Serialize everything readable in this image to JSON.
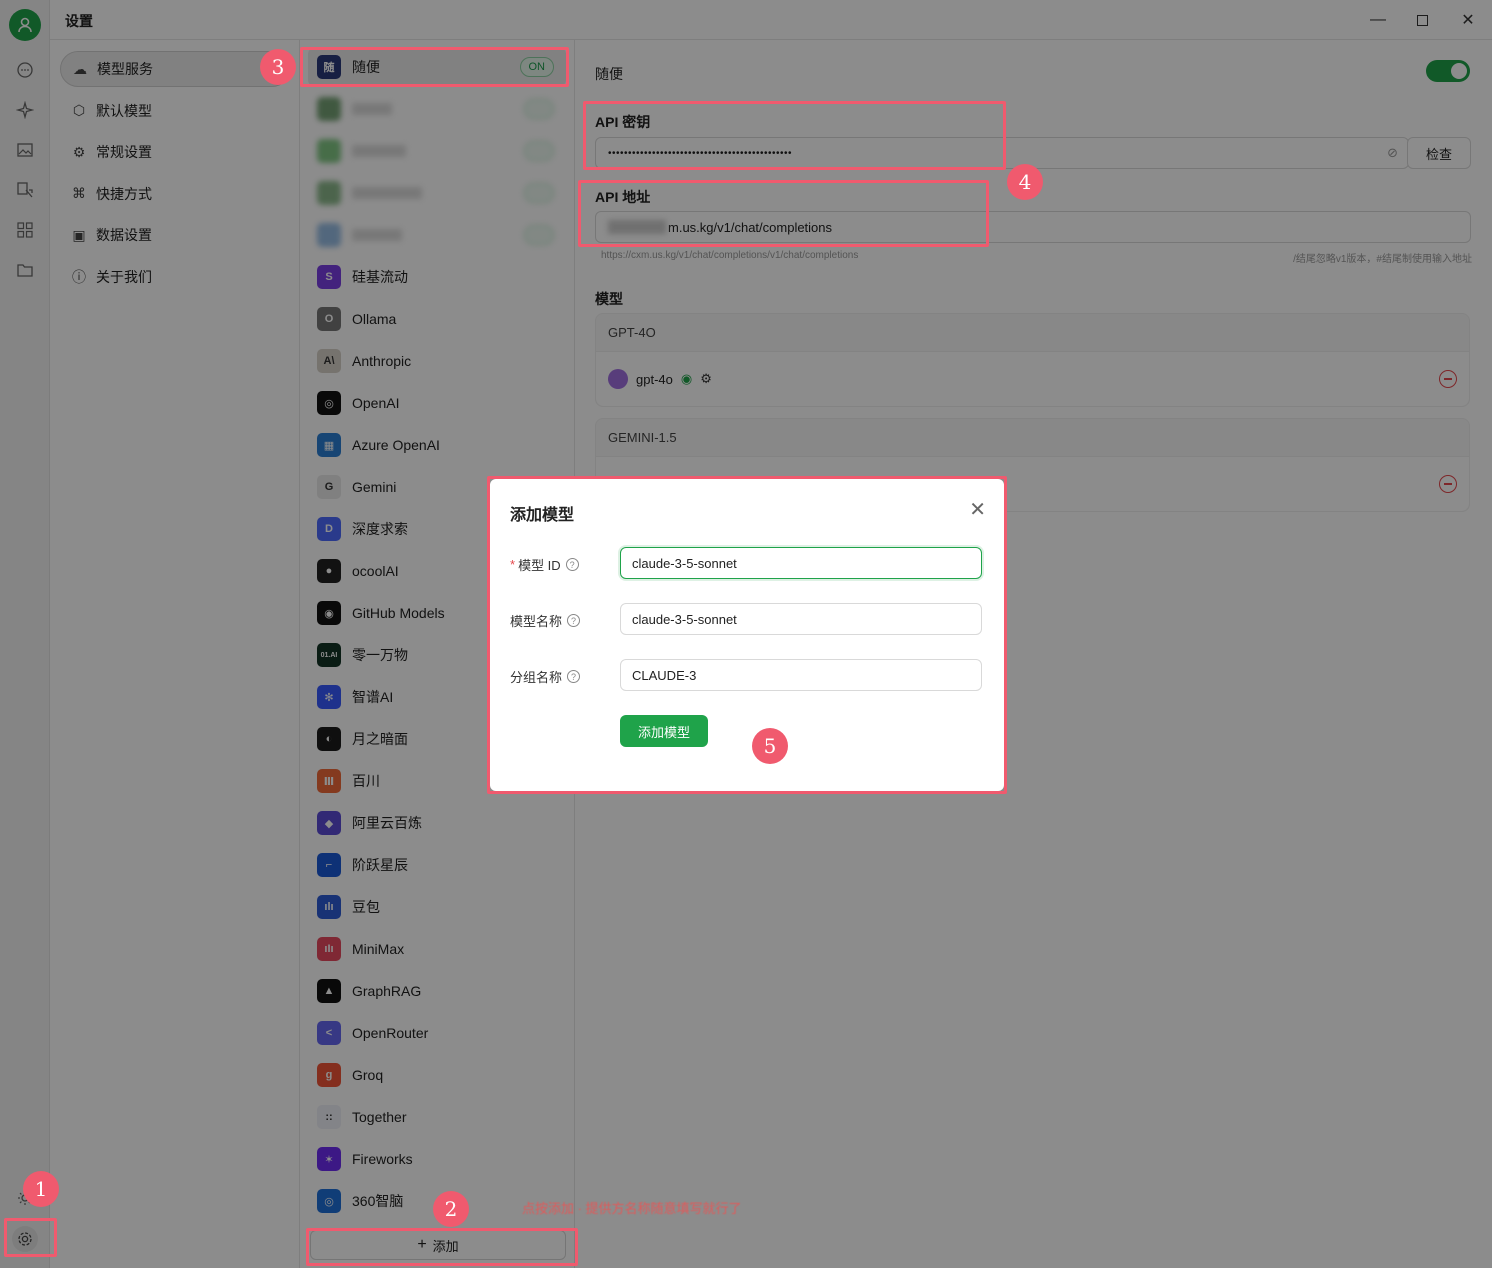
{
  "window": {
    "title": "设置"
  },
  "menu": [
    {
      "label": "模型服务",
      "icon": "cloud-icon",
      "active": true
    },
    {
      "label": "默认模型",
      "icon": "cube-icon"
    },
    {
      "label": "常规设置",
      "icon": "gear-icon"
    },
    {
      "label": "快捷方式",
      "icon": "command-icon"
    },
    {
      "label": "数据设置",
      "icon": "save-icon"
    },
    {
      "label": "关于我们",
      "icon": "info-icon"
    }
  ],
  "providers": [
    {
      "name": "随便",
      "logo_text": "随",
      "color": "#2b3a7a",
      "status": "ON"
    },
    {
      "name": "硅基流动",
      "logo_text": "S",
      "color": "#7b3fe4"
    },
    {
      "name": "Ollama",
      "logo_text": "O",
      "color": "#777777"
    },
    {
      "name": "Anthropic",
      "logo_text": "A\\",
      "color": "#d8d2c8"
    },
    {
      "name": "OpenAI",
      "logo_text": "◎",
      "color": "#111111"
    },
    {
      "name": "Azure OpenAI",
      "logo_text": "▦",
      "color": "#2a7fd4"
    },
    {
      "name": "Gemini",
      "logo_text": "G",
      "color": "#e9e9e9"
    },
    {
      "name": "深度求索",
      "logo_text": "D",
      "color": "#4d6bfe"
    },
    {
      "name": "ocoolAI",
      "logo_text": "●",
      "color": "#222222"
    },
    {
      "name": "GitHub Models",
      "logo_text": "◉",
      "color": "#111111"
    },
    {
      "name": "零一万物",
      "logo_text": "01.AI",
      "color": "#133426"
    },
    {
      "name": "智谱AI",
      "logo_text": "✻",
      "color": "#3859ff"
    },
    {
      "name": "月之暗面",
      "logo_text": "◐",
      "color": "#1c1c1c"
    },
    {
      "name": "百川",
      "logo_text": "Ⅲ",
      "color": "#f06b3a"
    },
    {
      "name": "阿里云百炼",
      "logo_text": "◆",
      "color": "#5b4bd6"
    },
    {
      "name": "阶跃星辰",
      "logo_text": "⌐",
      "color": "#1a5ad8"
    },
    {
      "name": "豆包",
      "logo_text": "ılı",
      "color": "#2d5bd6"
    },
    {
      "name": "MiniMax",
      "logo_text": "ıIı",
      "color": "#e84a5f"
    },
    {
      "name": "GraphRAG",
      "logo_text": "▲",
      "color": "#111111"
    },
    {
      "name": "OpenRouter",
      "logo_text": "<",
      "color": "#6566f1"
    },
    {
      "name": "Groq",
      "logo_text": "g",
      "color": "#f05537"
    },
    {
      "name": "Together",
      "logo_text": "::",
      "color": "#eef0f8"
    },
    {
      "name": "Fireworks",
      "logo_text": "✶",
      "color": "#6d2cf2"
    },
    {
      "name": "360智脑",
      "logo_text": "◎",
      "color": "#1e6fd9"
    }
  ],
  "add_button": "添加",
  "note_text": "点按添加 · 提供方名称随意填写就行了",
  "detail": {
    "provider_title": "随便",
    "api_key_label": "API 密钥",
    "api_key_value": "••••••••••••••••••••••••••••••••••••••••••••••",
    "check_button": "检查",
    "api_url_label": "API 地址",
    "api_url_value": "m.us.kg/v1/chat/completions",
    "hint_left": "https://cxm.us.kg/v1/chat/completions/v1/chat/completions",
    "hint_right": "/结尾忽略v1版本，#结尾制使用输入地址",
    "models_label": "模型",
    "groups": [
      {
        "name": "GPT-4O",
        "model": "gpt-4o"
      },
      {
        "name": "GEMINI-1.5",
        "model": ""
      }
    ]
  },
  "modal": {
    "title": "添加模型",
    "model_id_label": "模型 ID",
    "model_id_value": "claude-3-5-sonnet",
    "model_name_label": "模型名称",
    "model_name_value": "claude-3-5-sonnet",
    "group_label": "分组名称",
    "group_value": "CLAUDE-3",
    "submit_label": "添加模型"
  },
  "badges": [
    "1",
    "2",
    "3",
    "4",
    "5"
  ],
  "colors": {
    "accent": "#1fa34a",
    "annotation": "#f05a6e"
  }
}
